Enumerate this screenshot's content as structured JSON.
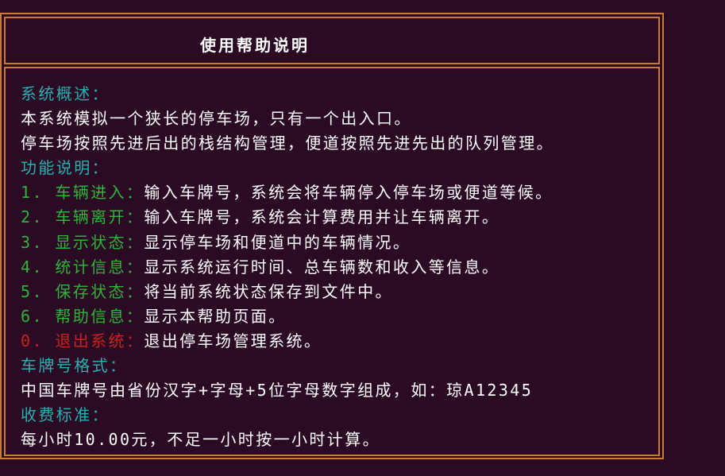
{
  "window": {
    "title": "使用帮助说明"
  },
  "sections": {
    "overview_heading": "系统概述：",
    "overview_lines": [
      "本系统模拟一个狭长的停车场，只有一个出入口。",
      "停车场按照先进后出的栈结构管理，便道按照先进先出的队列管理。"
    ],
    "function_heading": "功能说明：",
    "functions": [
      {
        "key": "1. 车辆进入：",
        "desc": "输入车牌号，系统会将车辆停入停车场或便道等候。"
      },
      {
        "key": "2. 车辆离开：",
        "desc": "输入车牌号，系统会计算费用并让车辆离开。"
      },
      {
        "key": "3. 显示状态：",
        "desc": "显示停车场和便道中的车辆情况。"
      },
      {
        "key": "4. 统计信息：",
        "desc": "显示系统运行时间、总车辆数和收入等信息。"
      },
      {
        "key": "5. 保存状态：",
        "desc": "将当前系统状态保存到文件中。"
      },
      {
        "key": "6. 帮助信息：",
        "desc": "显示本帮助页面。"
      },
      {
        "key": "0. 退出系统：",
        "desc": "退出停车场管理系统。"
      }
    ],
    "plate_heading": "车牌号格式：",
    "plate_text": "中国车牌号由省份汉字+字母+5位字母数字组成，如：琼A12345",
    "fee_heading": "收费标准：",
    "fee_text": "每小时10.00元，不足一小时按一小时计算。"
  },
  "colors": {
    "background": "#2b0b24",
    "border": "#c87a3a",
    "heading": "#2ab0b0",
    "option_key": "#2fb43a",
    "exit_key": "#c8231c",
    "text": "#ffffff"
  }
}
